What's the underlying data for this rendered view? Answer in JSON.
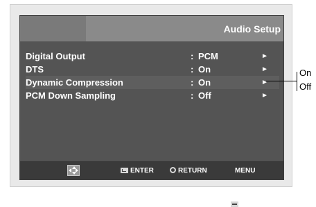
{
  "header": {
    "title": "Audio Setup"
  },
  "menu": {
    "items": [
      {
        "label": "Digital Output",
        "colon": ":",
        "value": "PCM",
        "arrow": "►"
      },
      {
        "label": "DTS",
        "colon": ":",
        "value": "On",
        "arrow": "►"
      },
      {
        "label": "Dynamic Compression",
        "colon": ":",
        "value": "On",
        "arrow": "►"
      },
      {
        "label": "PCM Down Sampling",
        "colon": ":",
        "value": "Off",
        "arrow": "►"
      }
    ]
  },
  "footer": {
    "enter_label": "ENTER",
    "return_label": "RETURN",
    "menu_label": "MENU"
  },
  "callout": {
    "option_on": "On",
    "option_off": "Off"
  }
}
